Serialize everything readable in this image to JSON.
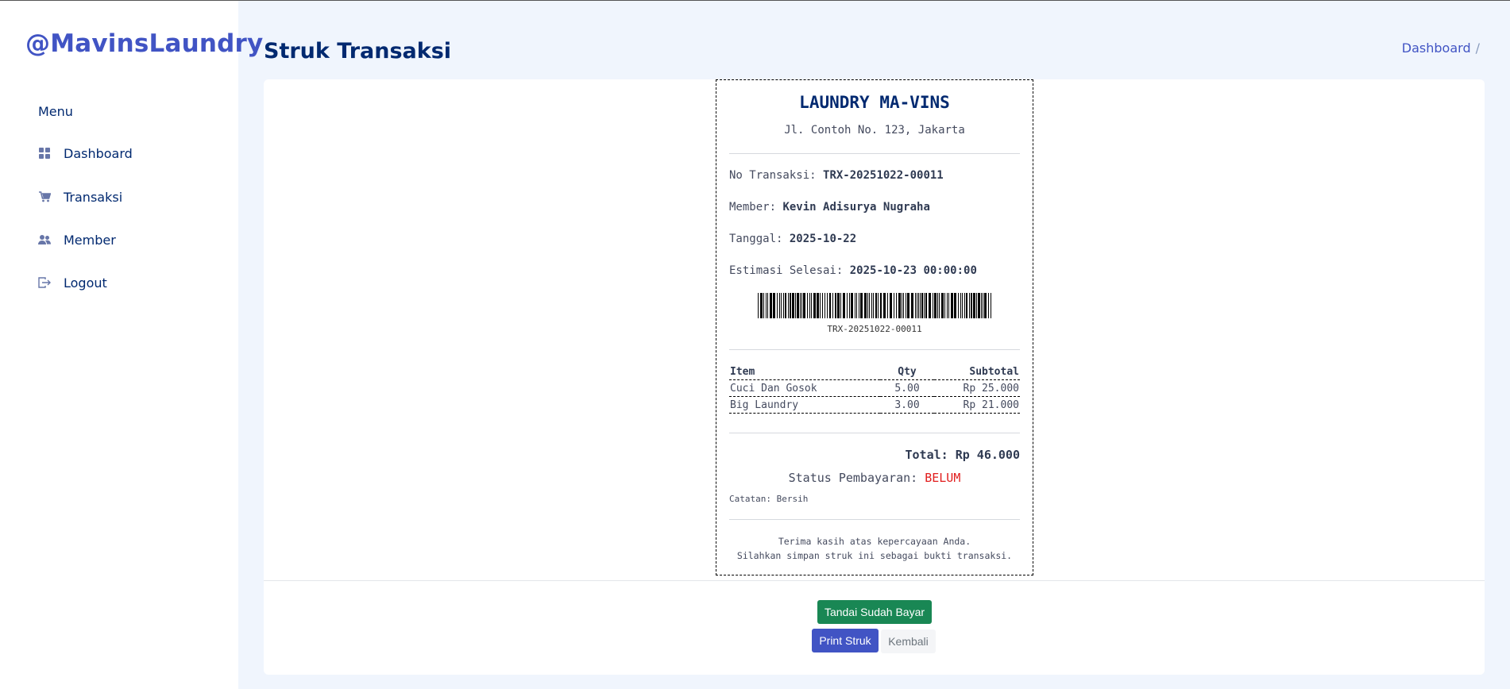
{
  "brand": "@MavinsLaundry",
  "sidebar": {
    "heading": "Menu",
    "items": [
      {
        "label": "Dashboard",
        "icon": "grid-icon"
      },
      {
        "label": "Transaksi",
        "icon": "cart-icon"
      },
      {
        "label": "Member",
        "icon": "people-icon"
      },
      {
        "label": "Logout",
        "icon": "logout-icon"
      }
    ]
  },
  "header": {
    "title": "Struk Transaksi",
    "breadcrumb": "Dashboard",
    "breadcrumb_sep": "/"
  },
  "receipt": {
    "title": "LAUNDRY MA-VINS",
    "address": "Jl. Contoh No. 123, Jakarta",
    "no_label": "No Transaksi:",
    "no_value": "TRX-20251022-00011",
    "member_label": "Member:",
    "member_value": "Kevin Adisurya Nugraha",
    "date_label": "Tanggal:",
    "date_value": "2025-10-22",
    "eta_label": "Estimasi Selesai:",
    "eta_value": "2025-10-23 00:00:00",
    "barcode_text": "TRX-20251022-00011",
    "table": {
      "headers": [
        "Item",
        "Qty",
        "Subtotal"
      ],
      "rows": [
        [
          "Cuci Dan Gosok",
          "5.00",
          "Rp 25.000"
        ],
        [
          "Big Laundry",
          "3.00",
          "Rp 21.000"
        ]
      ]
    },
    "total": "Total: Rp 46.000",
    "status_label": "Status Pembayaran:",
    "status_value": "BELUM",
    "note": "Catatan: Bersih",
    "thanks_1": "Terima kasih atas kepercayaan Anda.",
    "thanks_2": "Silahkan simpan struk ini sebagai bukti transaksi."
  },
  "buttons": {
    "mark_paid": "Tandai Sudah Bayar",
    "print": "Print Struk",
    "back": "Kembali"
  },
  "colors": {
    "brand": "#4154c4",
    "heading": "#012970",
    "paid_button": "#198754",
    "status_unpaid": "#e11d1d",
    "background": "#f0f5fd"
  }
}
